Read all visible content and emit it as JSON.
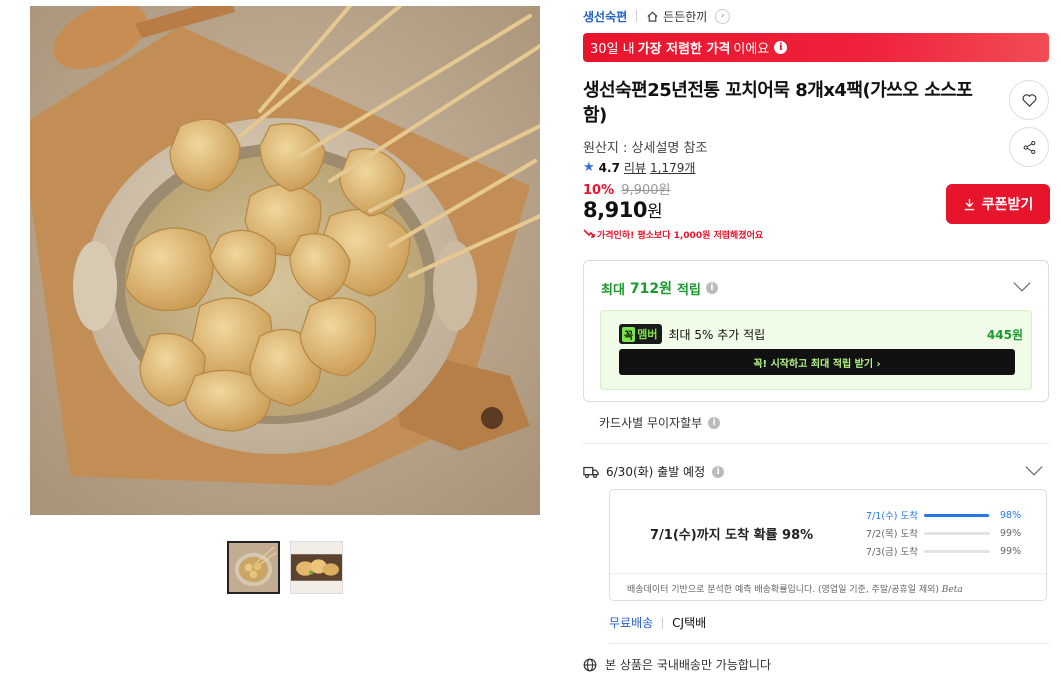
{
  "gallery": {
    "main_image": "fish-cake-skewers-in-clay-pot",
    "thumbnails": [
      "fish-cake-pot-thumbnail",
      "fish-cake-plate-thumbnail"
    ]
  },
  "breadcrumb": {
    "store": "생선숙편",
    "home": "든든한끼"
  },
  "promo": {
    "prefix": "30일 내",
    "highlight": "가장 저렴한 가격",
    "suffix": "이에요"
  },
  "product": {
    "title": "생선숙편25년전통 꼬치어묵 8개x4팩(가쓰오 소스포함)",
    "origin": "원산지 : 상세설명 참조",
    "rating": "4.7",
    "review_label": "리뷰",
    "review_count": "1,179개"
  },
  "price": {
    "discount": "10%",
    "original": "9,900원",
    "current": "8,910",
    "currency": "원",
    "drop_note": "가격인하! 평소보다 1,000원 저렴해졌어요"
  },
  "buttons": {
    "coupon": "쿠폰받기"
  },
  "points": {
    "prefix": "최대",
    "amount": "712원",
    "suffix": "적립",
    "member_badge_a": "꼭",
    "member_badge_b": "멤버",
    "member_text": "최대 5% 추가 적립",
    "member_amount": "445원",
    "member_cta": "꼭! 시작하고 최대 적립 받기  ›"
  },
  "installment": "카드사별 무이자할부",
  "shipping": {
    "dispatch": "6/30(화) 출발 예정",
    "headline": "7/1(수)까지 도착 확률 98%",
    "rows": [
      {
        "label": "7/1(수) 도착",
        "pct": "98%",
        "value": 0.98
      },
      {
        "label": "7/2(목) 도착",
        "pct": "99%",
        "value": 0.99
      },
      {
        "label": "7/3(금) 도착",
        "pct": "99%",
        "value": 0.99
      }
    ],
    "note": "배송데이터 기반으로 분석한 예측 배송확률입니다. (영업일 기준, 주말/공휴일 제외)",
    "beta": "Beta",
    "type_free": "무료배송",
    "carrier": "CJ택배",
    "domestic": "본 상품은 국내배송만 가능합니다"
  },
  "colors": {
    "accent_red": "#e8142c",
    "link_blue": "#2460c7",
    "points_green": "#1a9a2e",
    "bar_blue": "#2677e6"
  }
}
